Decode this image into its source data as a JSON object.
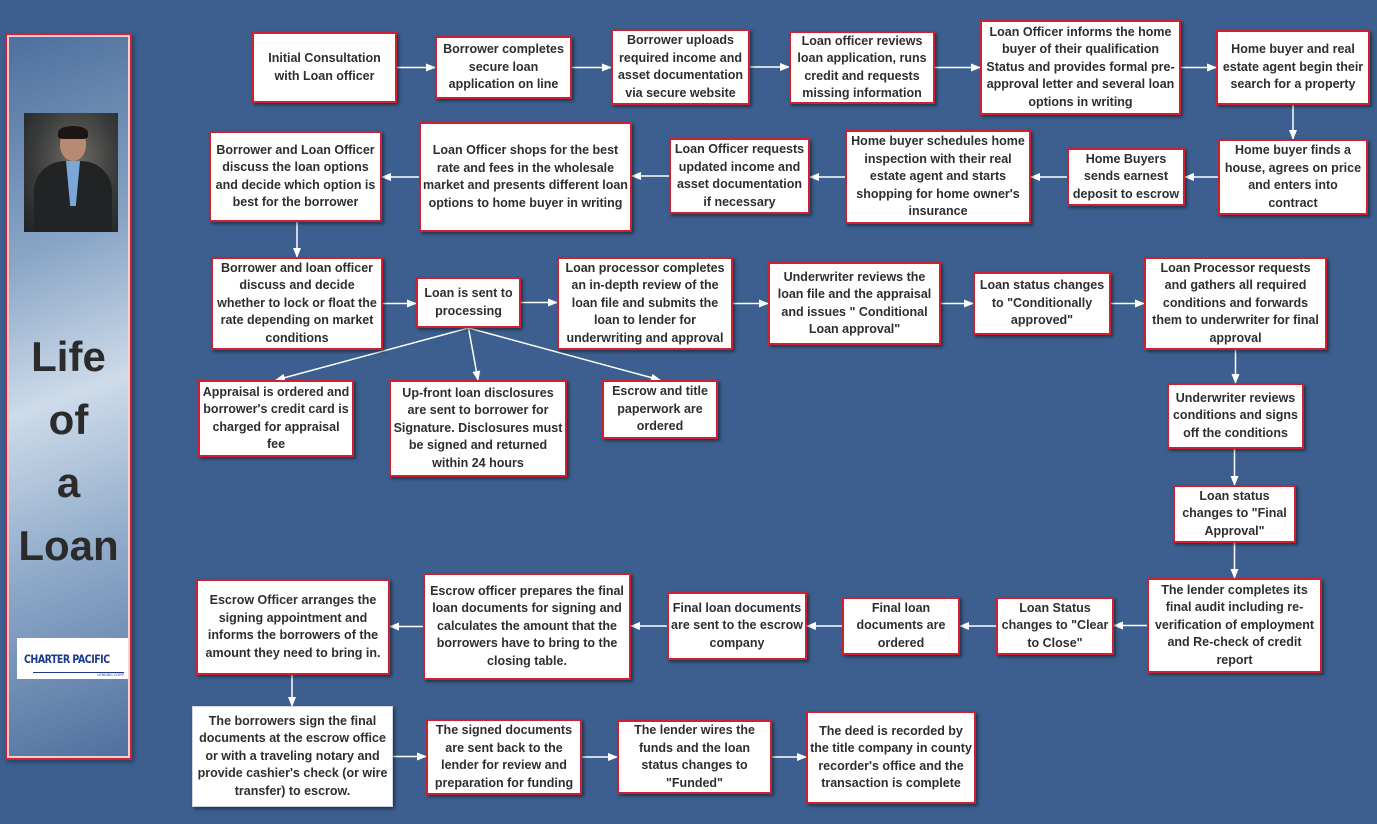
{
  "sidebar": {
    "title_lines": [
      "Life",
      "of",
      "a",
      "Loan"
    ],
    "photo": "loan-officer-portrait",
    "logo": {
      "brand": "CHARTER PACIFIC",
      "sub": "LENDING CORP",
      "icon": "lighthouse-icon"
    }
  },
  "colors": {
    "background": "#3c5f8f",
    "box_border": "#d01f2f",
    "arrow": "#ffffff"
  },
  "steps": [
    {
      "id": "s1",
      "text": "Initial Consultation with Loan officer"
    },
    {
      "id": "s2",
      "text": "Borrower completes secure loan application on line"
    },
    {
      "id": "s3",
      "text": "Borrower uploads required income and asset documentation via secure website"
    },
    {
      "id": "s4",
      "text": "Loan officer reviews loan application, runs credit and requests missing information"
    },
    {
      "id": "s5",
      "text": "Loan Officer informs the home buyer of their qualification Status and provides formal pre-approval letter and several loan options in writing"
    },
    {
      "id": "s6",
      "text": "Home buyer and real estate agent begin their search for a property"
    },
    {
      "id": "s7",
      "text": "Home buyer finds a house, agrees on price and enters into contract"
    },
    {
      "id": "s8",
      "text": "Home Buyers sends earnest deposit to escrow"
    },
    {
      "id": "s9",
      "text": "Home buyer schedules home inspection with their real estate agent and starts shopping for home owner's insurance"
    },
    {
      "id": "s10",
      "text": "Loan Officer requests updated income and asset documentation if necessary"
    },
    {
      "id": "s11",
      "text": "Loan Officer shops for the best rate and fees in the wholesale market and presents different loan options to home buyer in writing"
    },
    {
      "id": "s12",
      "text": "Borrower and Loan Officer discuss the loan options and decide which option is best for the borrower"
    },
    {
      "id": "s13",
      "text": "Borrower and loan officer discuss and decide whether to lock or float the rate depending on market conditions"
    },
    {
      "id": "s14",
      "text": "Loan is sent to processing"
    },
    {
      "id": "s15",
      "text": "Loan processor completes an in-depth review of the loan file and submits the loan to lender for underwriting and approval"
    },
    {
      "id": "s16",
      "text": "Underwriter reviews the loan file and the appraisal and issues \" Conditional Loan approval\""
    },
    {
      "id": "s17",
      "text": "Loan status changes to \"Conditionally approved\""
    },
    {
      "id": "s18",
      "text": "Loan Processor requests and gathers all required conditions and forwards them to underwriter for final approval"
    },
    {
      "id": "s19",
      "text": "Appraisal is ordered and borrower's credit card is charged for appraisal fee"
    },
    {
      "id": "s20",
      "text": "Up-front loan disclosures are sent to borrower for Signature. Disclosures must be signed and returned within 24 hours"
    },
    {
      "id": "s21",
      "text": "Escrow and title paperwork are ordered"
    },
    {
      "id": "s22",
      "text": "Underwriter reviews conditions and signs off the conditions"
    },
    {
      "id": "s23",
      "text": "Loan status changes to \"Final Approval\""
    },
    {
      "id": "s24",
      "text": "The lender completes its final audit including re-verification of employment and Re-check of credit report"
    },
    {
      "id": "s25",
      "text": "Loan Status changes to \"Clear to Close\""
    },
    {
      "id": "s26",
      "text": "Final loan documents are ordered"
    },
    {
      "id": "s27",
      "text": "Final loan documents are sent to the escrow company"
    },
    {
      "id": "s28",
      "text": "Escrow officer prepares the final loan documents for signing and calculates the amount that the borrowers have to bring to the closing table."
    },
    {
      "id": "s29",
      "text": "Escrow Officer arranges the signing appointment and informs the borrowers of the amount they need to bring in."
    },
    {
      "id": "s30",
      "text": "The borrowers sign the final documents at the escrow office or with a traveling notary and provide cashier's check (or wire transfer) to escrow."
    },
    {
      "id": "s31",
      "text": "The signed documents are sent back to the lender for review and preparation for funding"
    },
    {
      "id": "s32",
      "text": "The lender wires the funds and the loan status changes to \"Funded\""
    },
    {
      "id": "s33",
      "text": "The deed is recorded by the title company in county recorder's office and the transaction is complete"
    }
  ],
  "edges": [
    [
      "s1",
      "s2"
    ],
    [
      "s2",
      "s3"
    ],
    [
      "s3",
      "s4"
    ],
    [
      "s4",
      "s5"
    ],
    [
      "s5",
      "s6"
    ],
    [
      "s6",
      "s7"
    ],
    [
      "s7",
      "s8"
    ],
    [
      "s8",
      "s9"
    ],
    [
      "s9",
      "s10"
    ],
    [
      "s10",
      "s11"
    ],
    [
      "s11",
      "s12"
    ],
    [
      "s12",
      "s13"
    ],
    [
      "s13",
      "s14"
    ],
    [
      "s14",
      "s15"
    ],
    [
      "s15",
      "s16"
    ],
    [
      "s16",
      "s17"
    ],
    [
      "s17",
      "s18"
    ],
    [
      "s14",
      "s19"
    ],
    [
      "s14",
      "s20"
    ],
    [
      "s14",
      "s21"
    ],
    [
      "s18",
      "s22"
    ],
    [
      "s22",
      "s23"
    ],
    [
      "s23",
      "s24"
    ],
    [
      "s24",
      "s25"
    ],
    [
      "s25",
      "s26"
    ],
    [
      "s26",
      "s27"
    ],
    [
      "s27",
      "s28"
    ],
    [
      "s28",
      "s29"
    ],
    [
      "s29",
      "s30"
    ],
    [
      "s30",
      "s31"
    ],
    [
      "s31",
      "s32"
    ],
    [
      "s32",
      "s33"
    ]
  ]
}
